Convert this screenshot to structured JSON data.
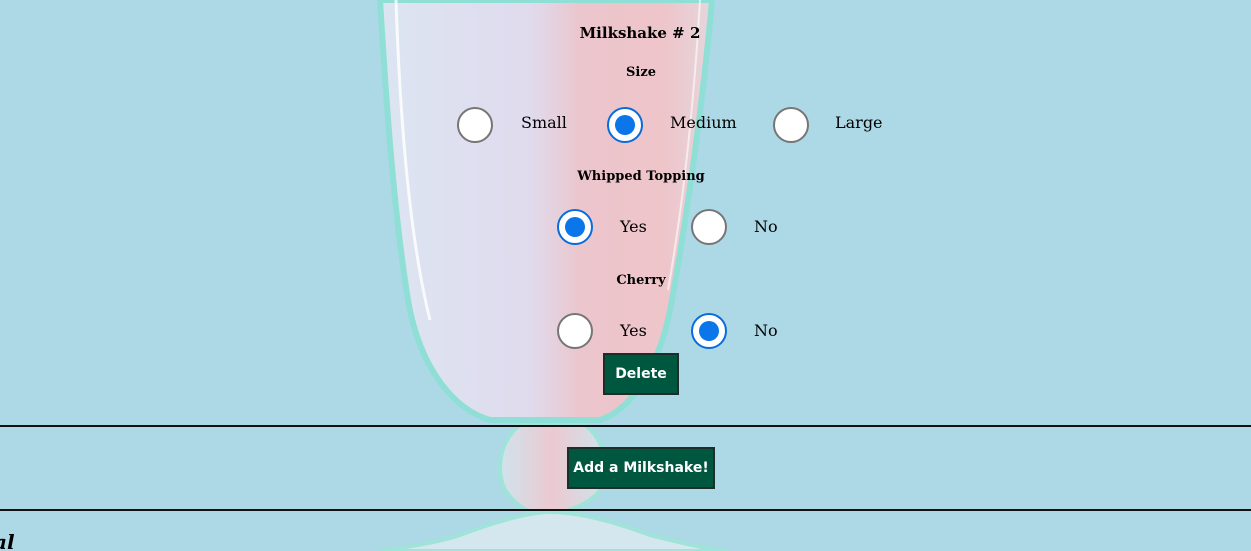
{
  "form": {
    "title": "Milkshake # 2",
    "size": {
      "label": "Size",
      "options": [
        "Small",
        "Medium",
        "Large"
      ],
      "selected": "Medium"
    },
    "whipped": {
      "label": "Whipped Topping",
      "options": [
        "Yes",
        "No"
      ],
      "selected": "Yes"
    },
    "cherry": {
      "label": "Cherry",
      "options": [
        "Yes",
        "No"
      ],
      "selected": "No"
    },
    "delete_label": "Delete"
  },
  "actions": {
    "add_label": "Add a Milkshake!"
  },
  "footer": {
    "partial_text": "al"
  },
  "colors": {
    "background": "#add8e6",
    "button": "#00573f",
    "radio_checked": "#0a76ea"
  }
}
